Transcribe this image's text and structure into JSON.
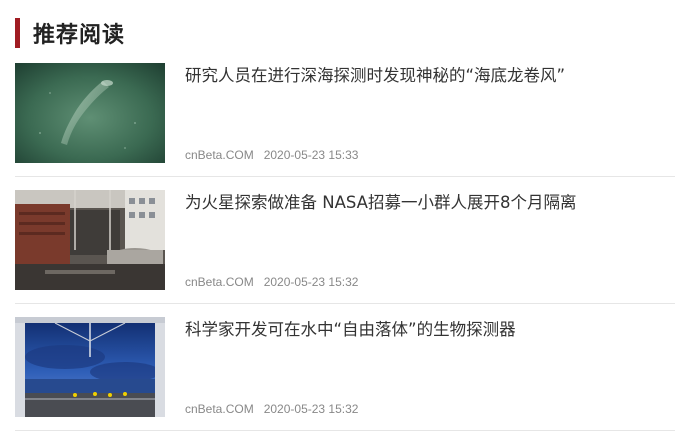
{
  "section": {
    "title": "推荐阅读",
    "accent_color": "#a01c22"
  },
  "articles": [
    {
      "title": "研究人员在进行深海探测时发现神秘的“海底龙卷风”",
      "source": "cnBeta.COM",
      "time": "2020-05-23 15:33",
      "thumbnail": "deep-sea-image"
    },
    {
      "title": "为火星探索做准备 NASA招募一小群人展开8个月隔离",
      "source": "cnBeta.COM",
      "time": "2020-05-23 15:32",
      "thumbnail": "ship-deck-image"
    },
    {
      "title": "科学家开发可在水中“自由落体”的生物探测器",
      "source": "cnBeta.COM",
      "time": "2020-05-23 15:32",
      "thumbnail": "ocean-dusk-image"
    }
  ]
}
